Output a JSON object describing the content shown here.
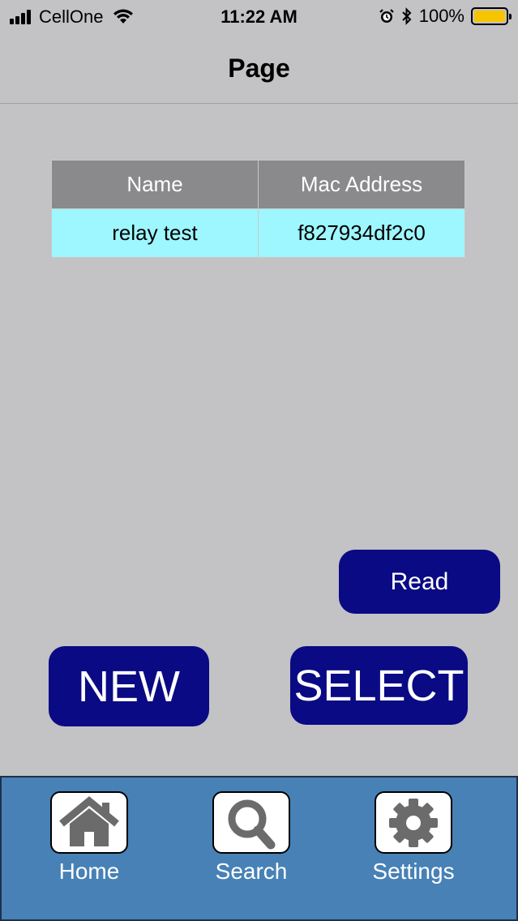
{
  "status_bar": {
    "carrier": "CellOne",
    "time": "11:22 AM",
    "battery_percent": "100%",
    "signal_icon": "cellular-signal-icon",
    "wifi_icon": "wifi-icon",
    "alarm_icon": "alarm-clock-icon",
    "bluetooth_icon": "bluetooth-icon",
    "battery_level": 1.0
  },
  "nav": {
    "title": "Page"
  },
  "table": {
    "headers": [
      "Name",
      "Mac Address"
    ],
    "rows": [
      [
        "relay test",
        "f827934df2c0"
      ]
    ]
  },
  "buttons": {
    "read": "Read",
    "new": "NEW",
    "select": "SELECT"
  },
  "tabs": [
    {
      "label": "Home",
      "icon": "house-icon"
    },
    {
      "label": "Search",
      "icon": "magnifier-icon"
    },
    {
      "label": "Settings",
      "icon": "gear-icon"
    }
  ],
  "colors": {
    "background": "#c3c2c4",
    "button": "#0a0a84",
    "table_header": "#8a898b",
    "table_row": "#9ef6fe",
    "tab_bar": "#4781b6",
    "battery": "#f7c500"
  }
}
